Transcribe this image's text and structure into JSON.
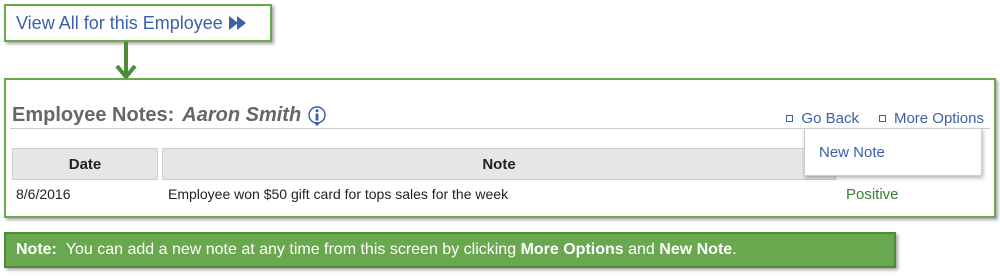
{
  "callout": {
    "view_all_label": "View All for this Employee"
  },
  "panel": {
    "title_label": "Employee Notes:",
    "employee_name": "Aaron Smith",
    "links": {
      "go_back": "Go Back",
      "more_options": "More Options"
    },
    "dropdown": {
      "new_note": "New Note"
    },
    "table": {
      "headers": {
        "date": "Date",
        "note": "Note"
      },
      "rows": [
        {
          "date": "8/6/2016",
          "note": "Employee won $50 gift card for tops sales for the week",
          "status": "Positive"
        }
      ]
    }
  },
  "note_banner": {
    "lead": "Note:",
    "text1": "You can add a new note at any time from this screen by clicking",
    "bold1": "More Options",
    "text2": "and",
    "bold2": "New Note",
    "end": "."
  },
  "colors": {
    "accent_green": "#6aa84f",
    "link_blue": "#3b5fa8",
    "positive_green": "#3a7d3a"
  }
}
